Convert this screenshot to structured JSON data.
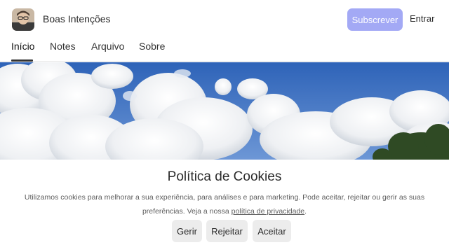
{
  "header": {
    "publication_name": "Boas Intenções",
    "subscribe_label": "Subscrever",
    "login_label": "Entrar",
    "subscribe_color": "#a3a9f5"
  },
  "nav": {
    "items": [
      {
        "label": "Início",
        "active": true
      },
      {
        "label": "Notes"
      },
      {
        "label": "Arquivo"
      },
      {
        "label": "Sobre"
      }
    ]
  },
  "hero": {
    "image": "sky-with-clouds"
  },
  "cookie_banner": {
    "title": "Política de Cookies",
    "text_before_link": "Utilizamos cookies para melhorar a sua experiência, para análises e para marketing. Pode aceitar, rejeitar ou gerir as suas preferências. Veja a nossa ",
    "link_label": "política de privacidade",
    "text_after_link": ".",
    "buttons": {
      "manage": "Gerir",
      "reject": "Rejeitar",
      "accept": "Aceitar"
    }
  }
}
